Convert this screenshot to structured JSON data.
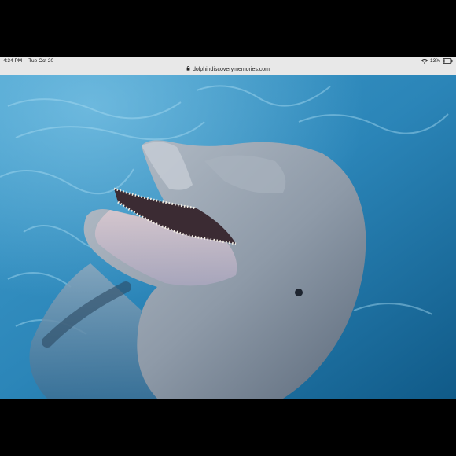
{
  "status_bar": {
    "time": "4:34 PM",
    "date": "Tue Oct 20",
    "battery_percent": "13%",
    "battery_level": 0.13,
    "wifi_icon": "wifi-icon",
    "battery_icon": "battery-icon"
  },
  "browser": {
    "url": "dolphindiscoverymemories.com",
    "lock_icon": "lock-icon"
  },
  "colors": {
    "water_light": "#3f9ccb",
    "water_dark": "#105a88",
    "dolphin": "#9aa6b3"
  }
}
